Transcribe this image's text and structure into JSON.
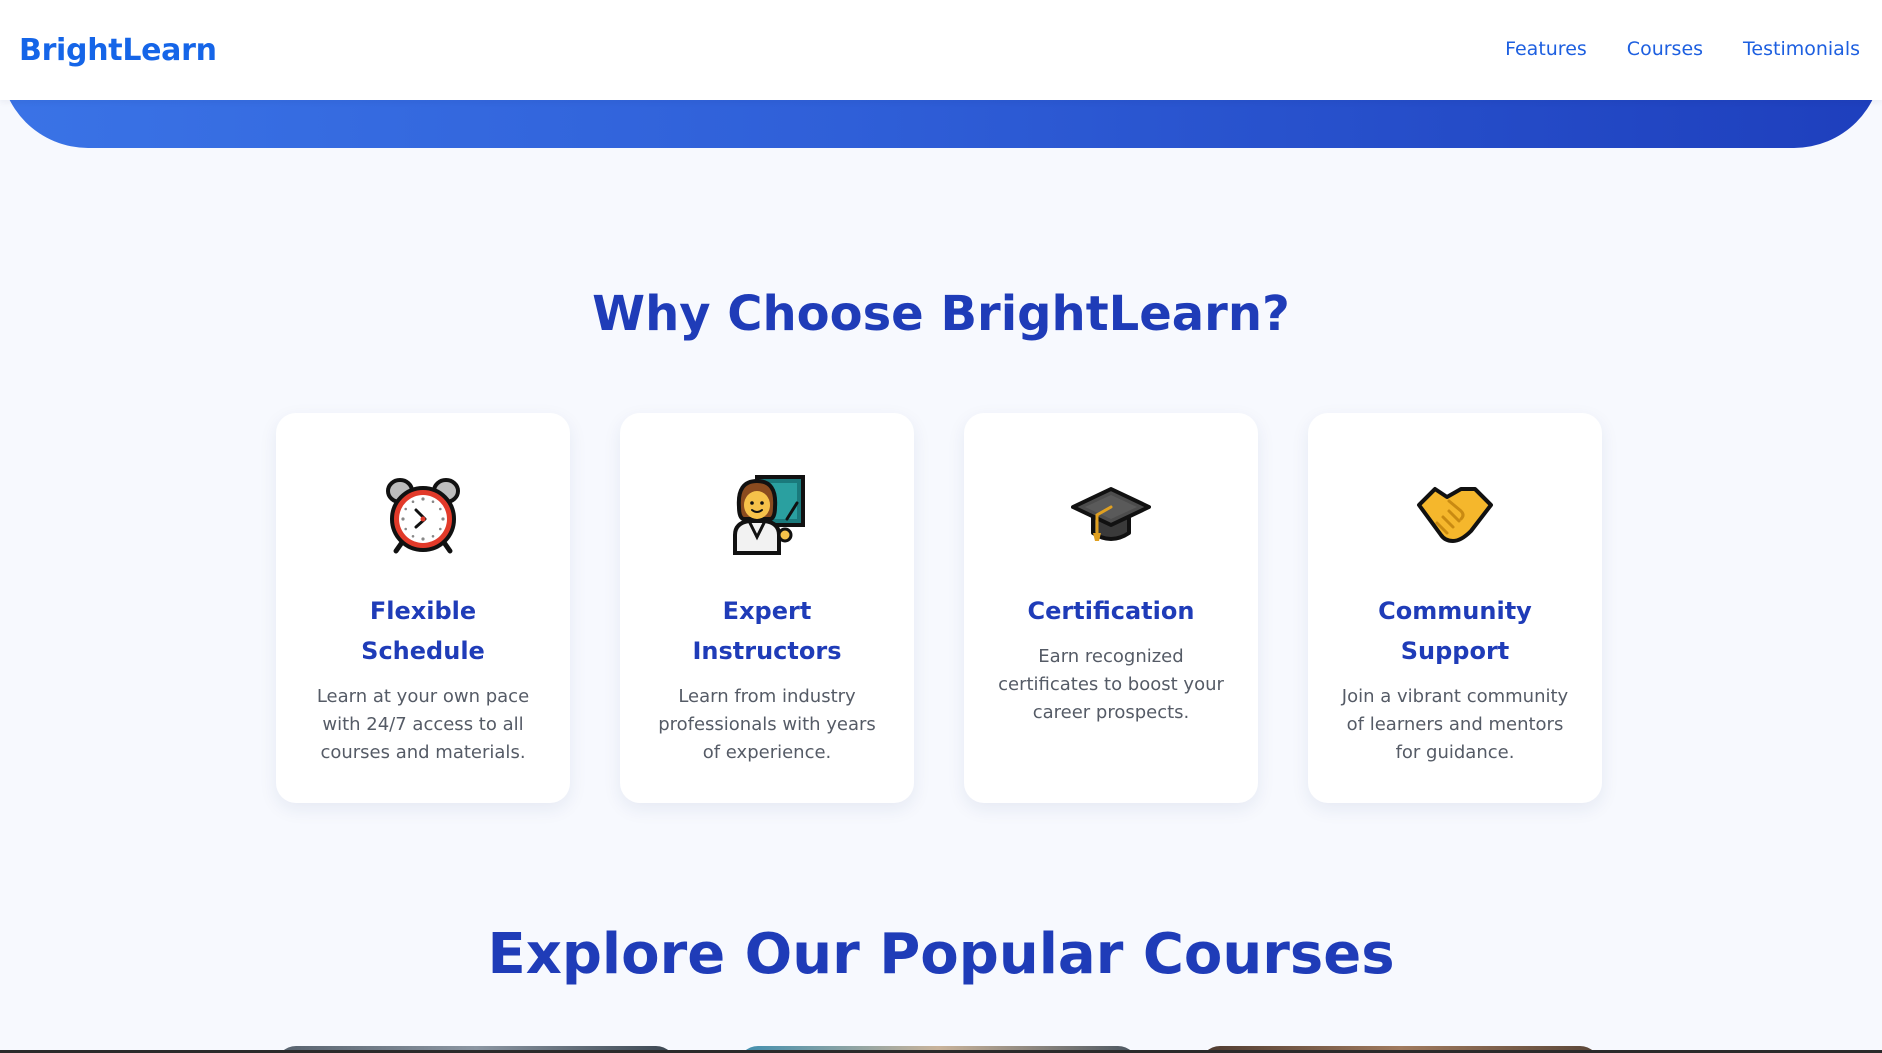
{
  "header": {
    "logo": "BrightLearn",
    "nav": [
      {
        "label": "Features"
      },
      {
        "label": "Courses"
      },
      {
        "label": "Testimonials"
      }
    ]
  },
  "features": {
    "title": "Why Choose BrightLearn?",
    "cards": [
      {
        "icon": "alarm-clock-icon",
        "title": "Flexible Schedule",
        "description": "Learn at your own pace with 24/7 access to all courses and materials."
      },
      {
        "icon": "teacher-icon",
        "title": "Expert Instructors",
        "description": "Learn from industry professionals with years of experience."
      },
      {
        "icon": "graduation-cap-icon",
        "title": "Certification",
        "description": "Earn recognized certificates to boost your career prospects."
      },
      {
        "icon": "handshake-icon",
        "title": "Community Support",
        "description": "Join a vibrant community of learners and mentors for guidance."
      }
    ]
  },
  "courses": {
    "title": "Explore Our Popular Courses"
  },
  "colors": {
    "brand": "#1565e8",
    "heading": "#1f3cb8",
    "hero_start": "#3a73e6",
    "hero_end": "#1e3fbd",
    "background": "#f7f9fe"
  }
}
